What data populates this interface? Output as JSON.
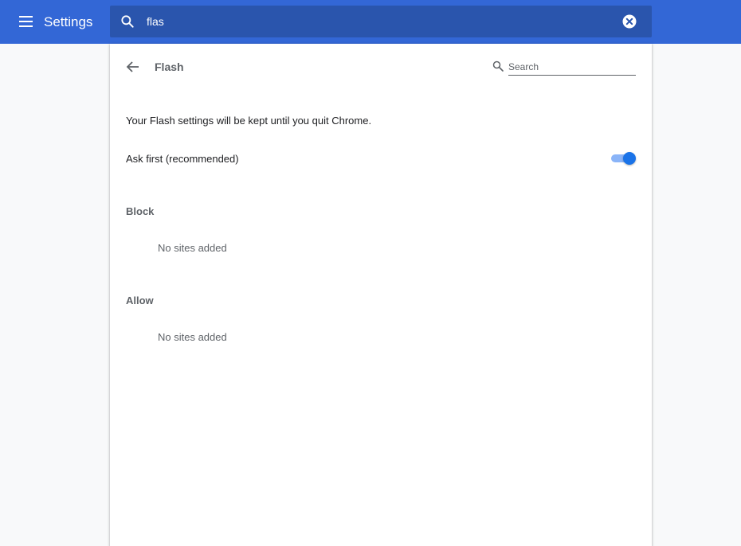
{
  "header": {
    "title": "Settings",
    "search_value": "flas"
  },
  "subpage": {
    "title": "Flash",
    "search_placeholder": "Search",
    "info_text": "Your Flash settings will be kept until you quit Chrome.",
    "toggle_label": "Ask first (recommended)",
    "toggle_on": true
  },
  "sections": {
    "block": {
      "heading": "Block",
      "empty_text": "No sites added"
    },
    "allow": {
      "heading": "Allow",
      "empty_text": "No sites added"
    }
  },
  "colors": {
    "toolbar": "#3367d6",
    "searchbox": "#2a55ad",
    "accent": "#1a73e8"
  }
}
